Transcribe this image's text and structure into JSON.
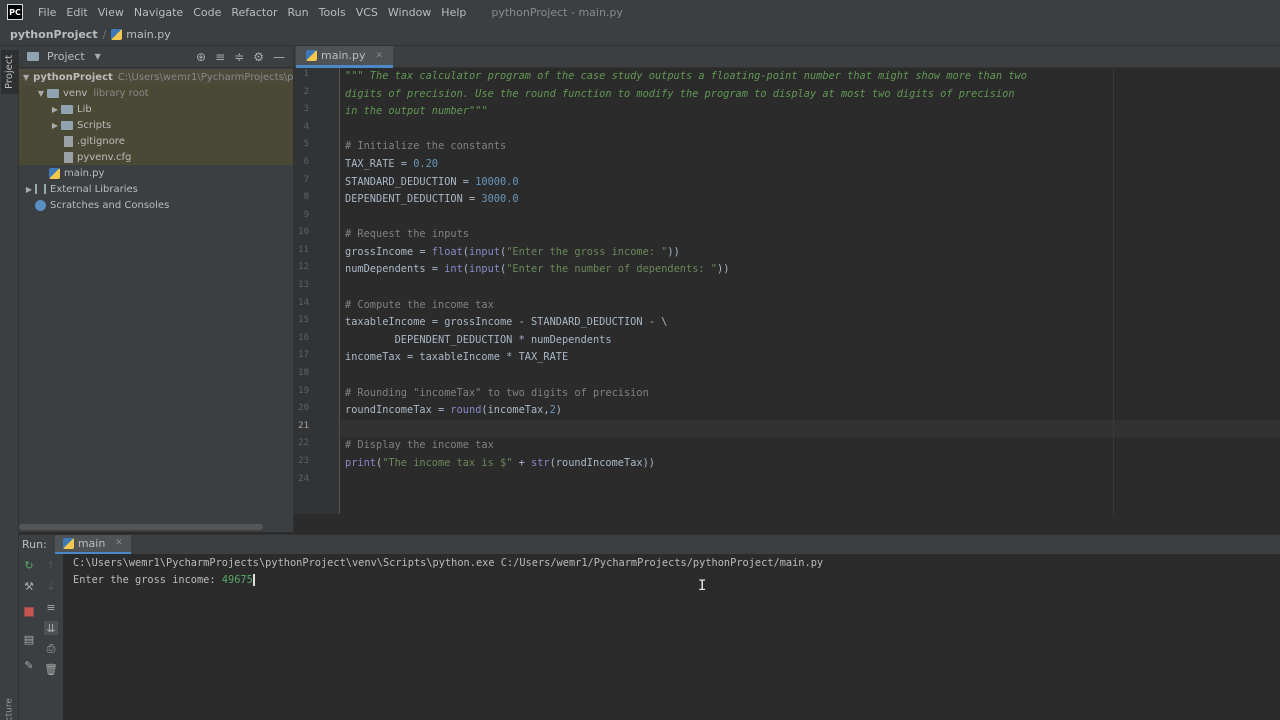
{
  "menubar": {
    "logo": "PC",
    "items": [
      "File",
      "Edit",
      "View",
      "Navigate",
      "Code",
      "Refactor",
      "Run",
      "Tools",
      "VCS",
      "Window",
      "Help"
    ],
    "window_title": "pythonProject - main.py"
  },
  "navbar": {
    "project": "pythonProject",
    "file": "main.py"
  },
  "left_stripe": {
    "project_tab": "Project",
    "structure_tab": "Structure"
  },
  "project_panel": {
    "title": "Project",
    "tree": {
      "root_name": "pythonProject",
      "root_path": "C:\\Users\\wemr1\\PycharmProjects\\pythonProject",
      "venv": "venv",
      "venv_note": "library root",
      "lib": "Lib",
      "scripts": "Scripts",
      "gitignore": ".gitignore",
      "pyvenv": "pyvenv.cfg",
      "main": "main.py",
      "external": "External Libraries",
      "scratches": "Scratches and Consoles"
    }
  },
  "editor": {
    "tab_label": "main.py",
    "line_numbers": [
      "1",
      "2",
      "3",
      "4",
      "5",
      "6",
      "7",
      "8",
      "9",
      "10",
      "11",
      "12",
      "13",
      "14",
      "15",
      "16",
      "17",
      "18",
      "19",
      "20",
      "21",
      "22",
      "23",
      "24"
    ],
    "current_line": "21",
    "code": {
      "l1": "\"\"\" The tax calculator program of the case study outputs a floating-point number that might show more than two",
      "l2": "digits of precision. Use the round function to modify the program to display at most two digits of precision",
      "l3": "in the output number\"\"\"",
      "l5": "# Initialize the constants",
      "l6a": "TAX_RATE = ",
      "l6b": "0.20",
      "l7a": "STANDARD_DEDUCTION = ",
      "l7b": "10000.0",
      "l8a": "DEPENDENT_DEDUCTION = ",
      "l8b": "3000.0",
      "l10": "# Request the inputs",
      "l11a": "grossIncome = ",
      "l11b": "float",
      "l11c": "(",
      "l11d": "input",
      "l11e": "(",
      "l11f": "\"Enter the gross income: \"",
      "l11g": "))",
      "l12a": "numDependents = ",
      "l12b": "int",
      "l12c": "(",
      "l12d": "input",
      "l12e": "(",
      "l12f": "\"Enter the number of dependents: \"",
      "l12g": "))",
      "l14": "# Compute the income tax",
      "l15": "taxableIncome = grossIncome - STANDARD_DEDUCTION - \\",
      "l16": "        DEPENDENT_DEDUCTION * numDependents",
      "l17": "incomeTax = taxableIncome * TAX_RATE",
      "l19": "# Rounding \"incomeTax\" to two digits of precision",
      "l20a": "roundIncomeTax = ",
      "l20b": "round",
      "l20c": "(incomeTax,",
      "l20d": "2",
      "l20e": ")",
      "l22": "# Display the income tax",
      "l23a": "print",
      "l23b": "(",
      "l23c": "\"The income tax is $\"",
      "l23d": " + ",
      "l23e": "str",
      "l23f": "(roundIncomeTax))"
    }
  },
  "run_panel": {
    "label": "Run:",
    "tab": "main",
    "console_line1": "C:\\Users\\wemr1\\PycharmProjects\\pythonProject\\venv\\Scripts\\python.exe C:/Users/wemr1/PycharmProjects/pythonProject/main.py",
    "prompt": "Enter the gross income: ",
    "user_input": "49675"
  },
  "colors": {
    "accent": "#4a88c7",
    "docstring": "#629755",
    "comment": "#808080",
    "number": "#6897bb",
    "string": "#6a8759",
    "builtin": "#8888c6",
    "console_input": "#59a869"
  }
}
